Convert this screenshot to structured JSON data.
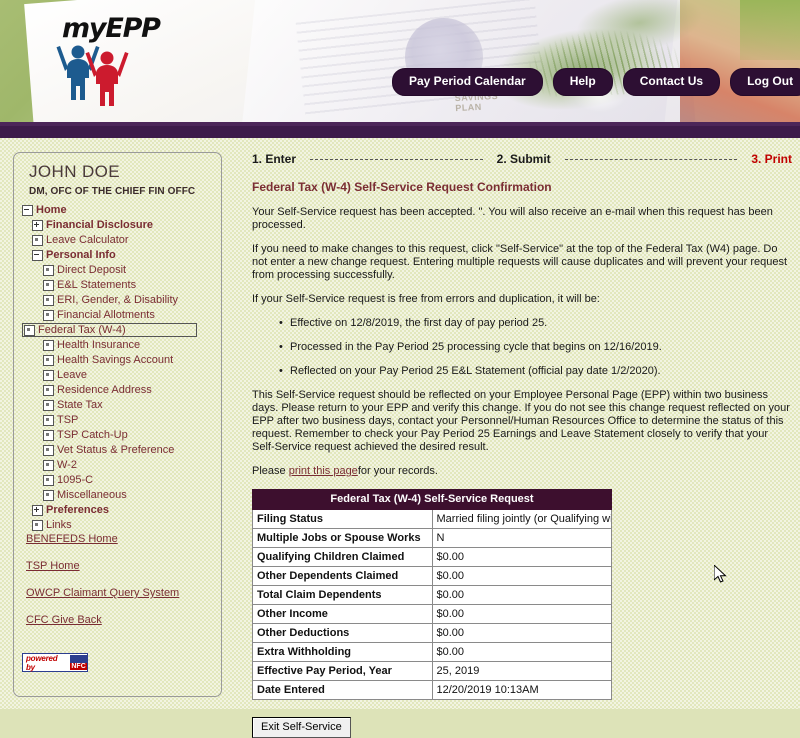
{
  "header": {
    "logo_text": "myEPP",
    "banner_watermark": "SAVINGS\nPLAN",
    "nav": [
      {
        "label": "Pay Period Calendar"
      },
      {
        "label": "Help"
      },
      {
        "label": "Contact Us"
      },
      {
        "label": "Log Out"
      }
    ]
  },
  "sidebar": {
    "user_name": "JOHN DOE",
    "user_org": "DM, OFC OF THE CHIEF FIN OFFC",
    "tree": [
      {
        "label": "Home",
        "toggle": "minus",
        "indent": 0,
        "bold": true,
        "selected": false
      },
      {
        "label": "Financial Disclosure",
        "toggle": "plus",
        "indent": 1,
        "bold": true,
        "selected": false
      },
      {
        "label": "Leave Calculator",
        "toggle": "leaf",
        "indent": 1,
        "bold": false,
        "selected": false
      },
      {
        "label": "Personal Info",
        "toggle": "minus",
        "indent": 1,
        "bold": true,
        "selected": false
      },
      {
        "label": "Direct Deposit",
        "toggle": "leaf",
        "indent": 2,
        "bold": false,
        "selected": false
      },
      {
        "label": "E&L Statements",
        "toggle": "leaf",
        "indent": 2,
        "bold": false,
        "selected": false
      },
      {
        "label": "ERI, Gender, & Disability",
        "toggle": "leaf",
        "indent": 2,
        "bold": false,
        "selected": false
      },
      {
        "label": "Financial Allotments",
        "toggle": "leaf",
        "indent": 2,
        "bold": false,
        "selected": false
      },
      {
        "label": "Federal Tax (W-4)",
        "toggle": "leaf",
        "indent": 2,
        "bold": false,
        "selected": true
      },
      {
        "label": "Health Insurance",
        "toggle": "leaf",
        "indent": 2,
        "bold": false,
        "selected": false
      },
      {
        "label": "Health Savings Account",
        "toggle": "leaf",
        "indent": 2,
        "bold": false,
        "selected": false
      },
      {
        "label": "Leave",
        "toggle": "leaf",
        "indent": 2,
        "bold": false,
        "selected": false
      },
      {
        "label": "Residence Address",
        "toggle": "leaf",
        "indent": 2,
        "bold": false,
        "selected": false
      },
      {
        "label": "State Tax",
        "toggle": "leaf",
        "indent": 2,
        "bold": false,
        "selected": false
      },
      {
        "label": "TSP",
        "toggle": "leaf",
        "indent": 2,
        "bold": false,
        "selected": false
      },
      {
        "label": "TSP Catch-Up",
        "toggle": "leaf",
        "indent": 2,
        "bold": false,
        "selected": false
      },
      {
        "label": "Vet Status & Preference",
        "toggle": "leaf",
        "indent": 2,
        "bold": false,
        "selected": false
      },
      {
        "label": "W-2",
        "toggle": "leaf",
        "indent": 2,
        "bold": false,
        "selected": false
      },
      {
        "label": "1095-C",
        "toggle": "leaf",
        "indent": 2,
        "bold": false,
        "selected": false
      },
      {
        "label": "Miscellaneous",
        "toggle": "leaf",
        "indent": 2,
        "bold": false,
        "selected": false
      },
      {
        "label": "Preferences",
        "toggle": "plus",
        "indent": 1,
        "bold": true,
        "selected": false
      },
      {
        "label": "Links",
        "toggle": "leaf",
        "indent": 1,
        "bold": false,
        "selected": false
      }
    ],
    "links": [
      {
        "label": "BENEFEDS Home"
      },
      {
        "label": "TSP Home"
      },
      {
        "label": "OWCP Claimant Query System"
      },
      {
        "label": "CFC Give Back"
      }
    ],
    "powered_by": {
      "text": "powered by",
      "badge": "NFC"
    }
  },
  "main": {
    "steps": [
      {
        "label": "1. Enter",
        "active": false
      },
      {
        "label": "2. Submit",
        "active": false
      },
      {
        "label": "3. Print",
        "active": true
      }
    ],
    "title": "Federal Tax (W-4) Self-Service Request Confirmation",
    "paragraph_1": "Your Self-Service request has been accepted. \". You will also receive an e-mail when this request has been processed.",
    "paragraph_2": "If you need to make changes to this request, click \"Self-Service\" at the top of the Federal Tax (W4) page. Do not enter a new change request. Entering multiple requests will cause duplicates and will prevent your request from processing successfully.",
    "paragraph_3": "If your Self-Service request is free from errors and duplication, it will be:",
    "bullets": [
      "Effective on 12/8/2019, the first day of pay period 25.",
      "Processed in the Pay Period 25 processing cycle that begins on 12/16/2019.",
      "Reflected on your Pay Period 25 E&L Statement (official pay date 1/2/2020)."
    ],
    "paragraph_4": "This Self-Service request should be reflected on your Employee Personal Page (EPP) within two business days. Please return to your EPP and verify this change. If you do not see this change request reflected on your EPP after two business days, contact your Personnel/Human Resources Office to determine the status of this request. Remember to check your Pay Period 25 Earnings and Leave Statement closely to verify that your Self-Service request achieved the desired result.",
    "print_prefix": "Please ",
    "print_link": "print this page",
    "print_suffix": "for your records.",
    "exit_button": "Exit Self-Service"
  },
  "table": {
    "header": "Federal Tax (W-4) Self-Service Request",
    "rows": [
      {
        "label": "Filing Status",
        "value": "Married filing jointly (or Qualifying widow(er))"
      },
      {
        "label": "Multiple Jobs or Spouse Works",
        "value": "N"
      },
      {
        "label": "Qualifying Children Claimed",
        "value": "$0.00"
      },
      {
        "label": "Other Dependents Claimed",
        "value": "$0.00"
      },
      {
        "label": "Total Claim Dependents",
        "value": "$0.00"
      },
      {
        "label": "Other Income",
        "value": "$0.00"
      },
      {
        "label": "Other Deductions",
        "value": "$0.00"
      },
      {
        "label": "Extra Withholding",
        "value": "$0.00"
      },
      {
        "label": "Effective Pay Period, Year",
        "value": "25, 2019"
      },
      {
        "label": "Date Entered",
        "value": "12/20/2019 10:13AM"
      }
    ]
  },
  "colors": {
    "page_background": "#e2e7bd",
    "divider": "#3d1b4a",
    "nav_button": "#2d0f33",
    "link": "#7a2d33",
    "active_step": "#c00000",
    "table_header": "#3d0f2e"
  }
}
